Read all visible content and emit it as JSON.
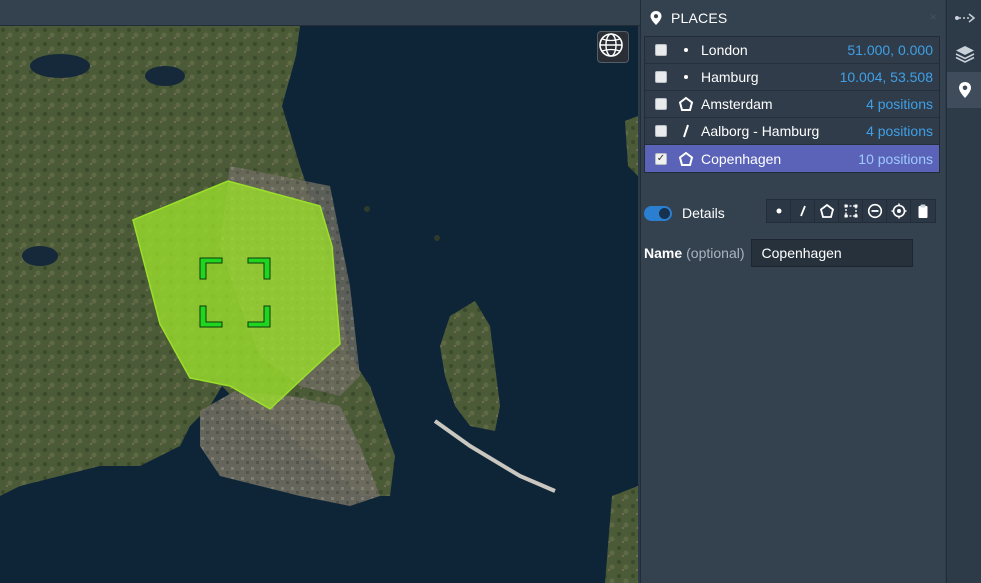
{
  "panel": {
    "title": "PLACES",
    "close_glyph": "×",
    "places": [
      {
        "name": "London",
        "type": "point",
        "info": "51.000, 0.000",
        "checked": false,
        "selected": false
      },
      {
        "name": "Hamburg",
        "type": "point",
        "info": "10.004, 53.508",
        "checked": false,
        "selected": false
      },
      {
        "name": "Amsterdam",
        "type": "polygon",
        "info": "4 positions",
        "checked": false,
        "selected": false
      },
      {
        "name": "Aalborg - Hamburg",
        "type": "line",
        "info": "4 positions",
        "checked": false,
        "selected": false
      },
      {
        "name": "Copenhagen",
        "type": "polygon",
        "info": "10 positions",
        "checked": true,
        "selected": true
      }
    ],
    "details_label": "Details",
    "details_enabled": true,
    "tools": [
      "point-tool-icon",
      "line-tool-icon",
      "polygon-tool-icon",
      "rectangle-tool-icon",
      "remove-circle-icon",
      "target-icon",
      "clipboard-icon"
    ],
    "name_label": "Name",
    "name_optional": "(optional)",
    "name_value": "Copenhagen"
  },
  "rail": [
    "route-icon",
    "layers-icon",
    "map-pin-icon"
  ],
  "colors": {
    "accent": "#2b7fd0",
    "selected_row": "#5a63b8",
    "info_text": "#3fa0e8",
    "polygon_fill": "#9be02a",
    "marker_green": "#1fd51f"
  }
}
